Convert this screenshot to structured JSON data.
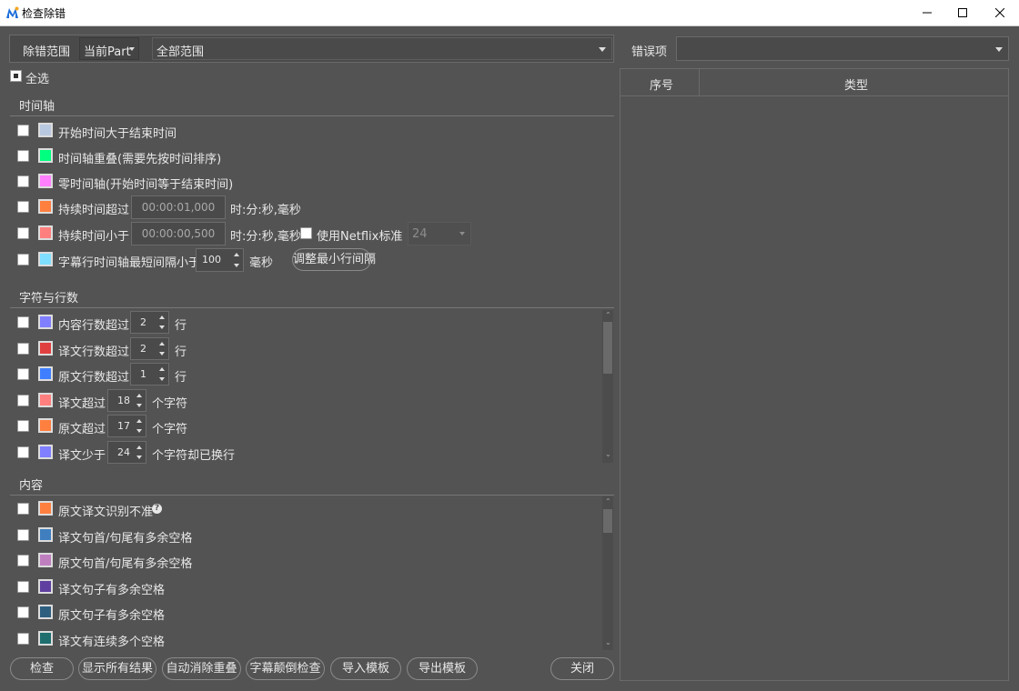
{
  "window": {
    "title": "检查除错"
  },
  "scope": {
    "label": "除错范围",
    "part": "当前Part",
    "range": "全部范围"
  },
  "error_filter": {
    "label": "错误项",
    "value": ""
  },
  "select_all": {
    "label": "全选"
  },
  "timeline": {
    "title": "时间轴",
    "items": {
      "start_gt_end": "开始时间大于结束时间",
      "overlap": "时间轴重叠(需要先按时间排序)",
      "zero": "零时间轴(开始时间等于结束时间)",
      "duration_over": "持续时间超过",
      "duration_over_value": "00:00:01,000",
      "duration_under": "持续时间小于",
      "duration_under_value": "00:00:00,500",
      "time_unit": "时:分:秒,毫秒",
      "netflix": "使用Netflix标准",
      "netflix_value": "24",
      "min_gap": "字幕行时间轴最短间隔小于",
      "min_gap_value": "100",
      "ms": "毫秒",
      "adjust_button": "调整最小行间隔"
    }
  },
  "chars_lines": {
    "title": "字符与行数",
    "rows": [
      {
        "label": "内容行数超过",
        "value": "2",
        "unit": "行",
        "color": "#7f7fff"
      },
      {
        "label": "译文行数超过",
        "value": "2",
        "unit": "行",
        "color": "#e04040"
      },
      {
        "label": "原文行数超过",
        "value": "1",
        "unit": "行",
        "color": "#3f7fff"
      },
      {
        "label": "译文超过",
        "value": "18",
        "unit": "个字符",
        "color": "#ff7f7f"
      },
      {
        "label": "原文超过",
        "value": "17",
        "unit": "个字符",
        "color": "#ff7f3f"
      },
      {
        "label": "译文少于",
        "value": "24",
        "unit": "个字符却已换行",
        "color": "#7f7fff"
      }
    ]
  },
  "content": {
    "title": "内容",
    "rows": [
      {
        "label": "原文译文识别不准",
        "color": "#ff7f3f"
      },
      {
        "label": "译文句首/句尾有多余空格",
        "color": "#3f7fbf"
      },
      {
        "label": "原文句首/句尾有多余空格",
        "color": "#bf7fbf"
      },
      {
        "label": "译文句子有多余空格",
        "color": "#5f3f9f"
      },
      {
        "label": "原文句子有多余空格",
        "color": "#2f5f7f"
      },
      {
        "label": "译文有连续多个空格",
        "color": "#1f6f6f"
      }
    ]
  },
  "colors": {
    "start_gt_end": "#b8c8e0",
    "overlap": "#00ff7f",
    "zero": "#ff7fff",
    "duration_over": "#ff7f3f",
    "duration_under": "#ff7f7f",
    "min_gap": "#7fdfff"
  },
  "buttons": {
    "check": "检查",
    "show_all": "显示所有结果",
    "auto_remove": "自动消除重叠",
    "reverse_check": "字幕颠倒检查",
    "import_tpl": "导入模板",
    "export_tpl": "导出模板",
    "close": "关闭"
  },
  "table": {
    "col_index": "序号",
    "col_type": "类型"
  }
}
